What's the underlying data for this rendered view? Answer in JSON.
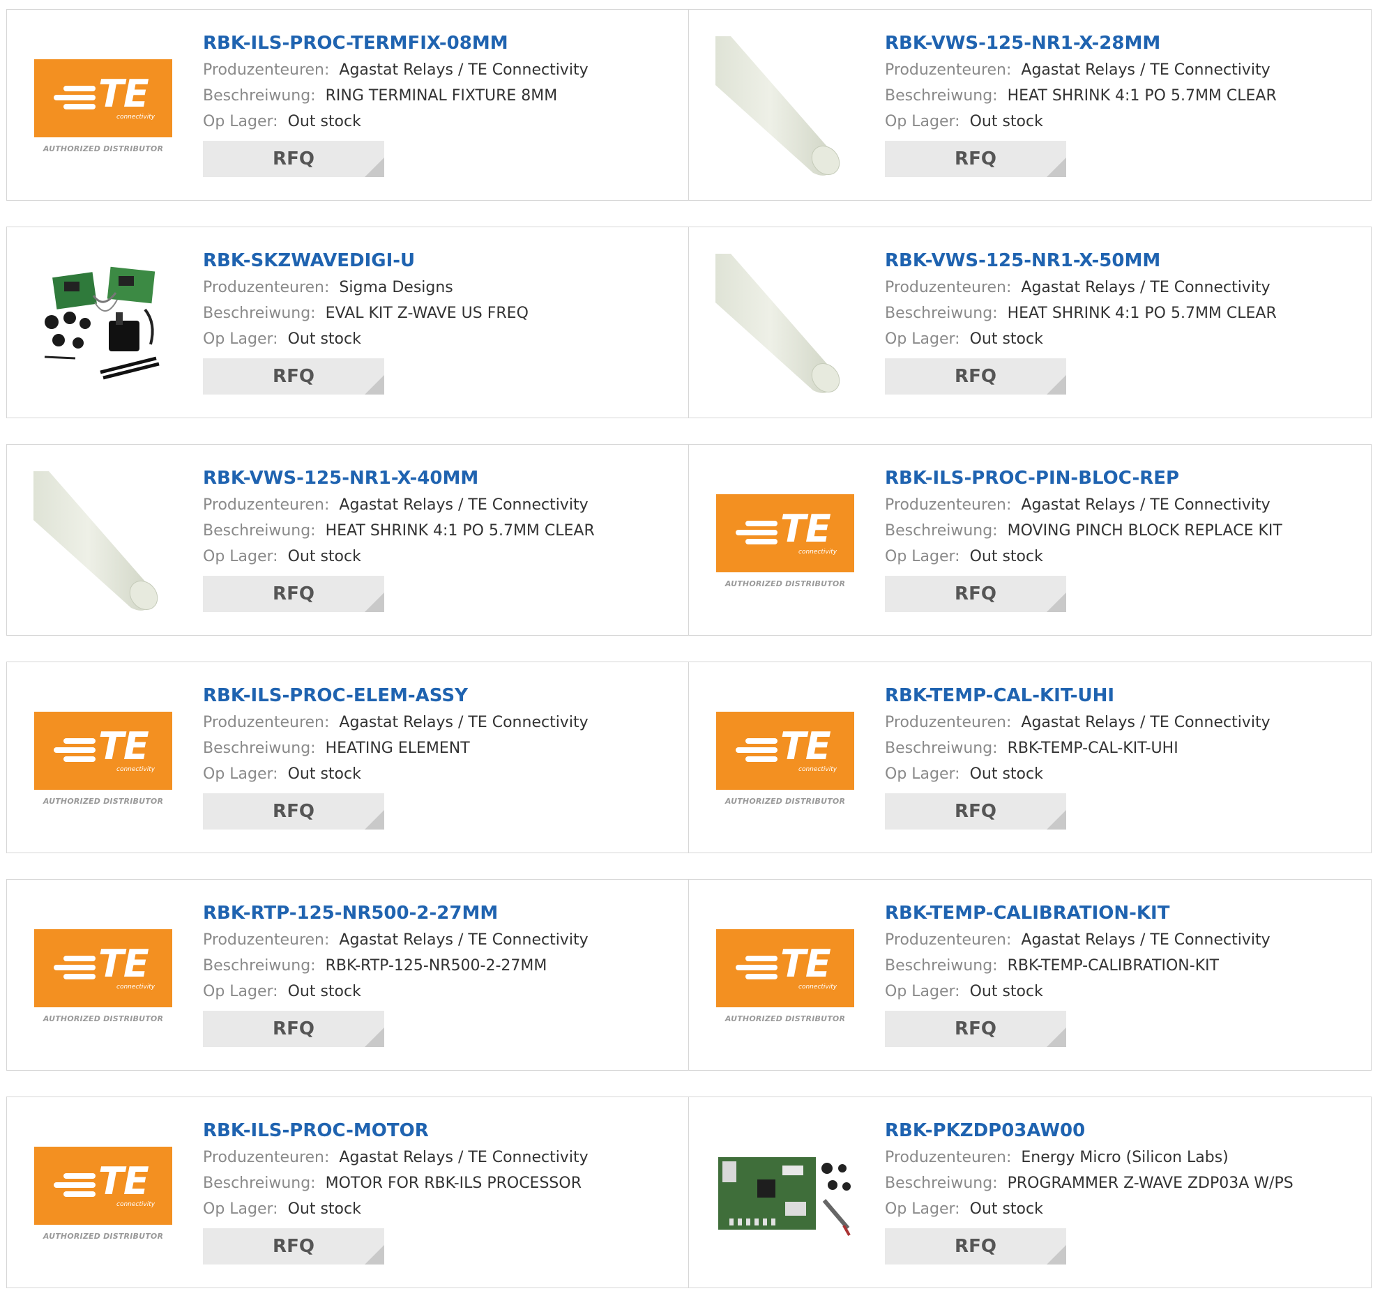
{
  "labels": {
    "manufacturer": "Produzenteuren:",
    "description": "Beschreiwung:",
    "stock": "Op Lager:"
  },
  "rfq_label": "RFQ",
  "te_logo": {
    "text": "TE",
    "subtext": "connectivity",
    "authorized": "AUTHORIZED DISTRIBUTOR"
  },
  "colors": {
    "part_link": "#1f63b0",
    "te_orange": "#f39021",
    "label_gray": "#8a8a8a"
  },
  "products": [
    {
      "part": "RBK-ILS-PROC-TERMFIX-08MM",
      "manufacturer": "Agastat Relays / TE Connectivity",
      "description": "RING TERMINAL FIXTURE 8MM",
      "stock": "Out stock",
      "image": "te-logo"
    },
    {
      "part": "RBK-VWS-125-NR1-X-28MM",
      "manufacturer": "Agastat Relays / TE Connectivity",
      "description": "HEAT SHRINK 4:1 PO 5.7MM CLEAR",
      "stock": "Out stock",
      "image": "heat-shrink-tube"
    },
    {
      "part": "RBK-SKZWAVEDIGI-U",
      "manufacturer": "Sigma Designs",
      "description": "EVAL KIT Z-WAVE US FREQ",
      "stock": "Out stock",
      "image": "eval-kit"
    },
    {
      "part": "RBK-VWS-125-NR1-X-50MM",
      "manufacturer": "Agastat Relays / TE Connectivity",
      "description": "HEAT SHRINK 4:1 PO 5.7MM CLEAR",
      "stock": "Out stock",
      "image": "heat-shrink-tube"
    },
    {
      "part": "RBK-VWS-125-NR1-X-40MM",
      "manufacturer": "Agastat Relays / TE Connectivity",
      "description": "HEAT SHRINK 4:1 PO 5.7MM CLEAR",
      "stock": "Out stock",
      "image": "heat-shrink-tube"
    },
    {
      "part": "RBK-ILS-PROC-PIN-BLOC-REP",
      "manufacturer": "Agastat Relays / TE Connectivity",
      "description": "MOVING PINCH BLOCK REPLACE KIT",
      "stock": "Out stock",
      "image": "te-logo"
    },
    {
      "part": "RBK-ILS-PROC-ELEM-ASSY",
      "manufacturer": "Agastat Relays / TE Connectivity",
      "description": "HEATING ELEMENT",
      "stock": "Out stock",
      "image": "te-logo"
    },
    {
      "part": "RBK-TEMP-CAL-KIT-UHI",
      "manufacturer": "Agastat Relays / TE Connectivity",
      "description": "RBK-TEMP-CAL-KIT-UHI",
      "stock": "Out stock",
      "image": "te-logo"
    },
    {
      "part": "RBK-RTP-125-NR500-2-27MM",
      "manufacturer": "Agastat Relays / TE Connectivity",
      "description": "RBK-RTP-125-NR500-2-27MM",
      "stock": "Out stock",
      "image": "te-logo"
    },
    {
      "part": "RBK-TEMP-CALIBRATION-KIT",
      "manufacturer": "Agastat Relays / TE Connectivity",
      "description": "RBK-TEMP-CALIBRATION-KIT",
      "stock": "Out stock",
      "image": "te-logo"
    },
    {
      "part": "RBK-ILS-PROC-MOTOR",
      "manufacturer": "Agastat Relays / TE Connectivity",
      "description": "MOTOR FOR RBK-ILS PROCESSOR",
      "stock": "Out stock",
      "image": "te-logo"
    },
    {
      "part": "RBK-PKZDP03AW00",
      "manufacturer": "Energy Micro (Silicon Labs)",
      "description": "PROGRAMMER Z-WAVE ZDP03A W/PS",
      "stock": "Out stock",
      "image": "programmer-board"
    }
  ]
}
